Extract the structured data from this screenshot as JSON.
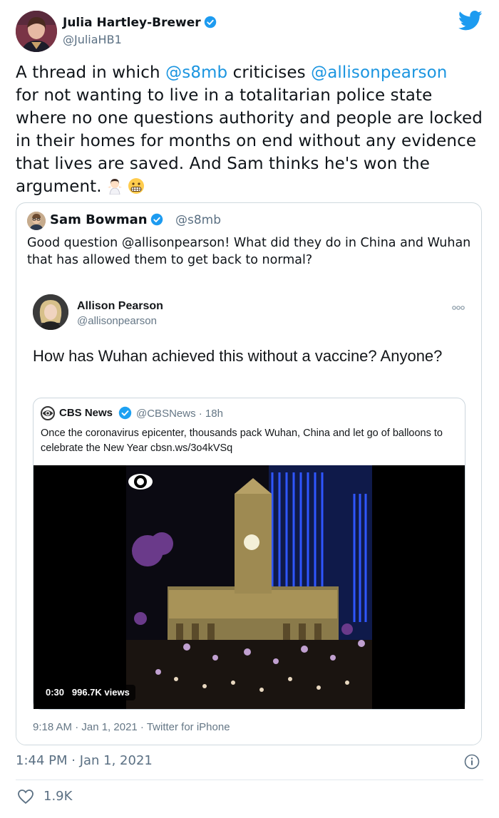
{
  "main_tweet": {
    "author_name": "Julia Hartley-Brewer",
    "author_handle": "@JuliaHB1",
    "text_1": "A thread in which ",
    "mention_1": "@s8mb",
    "text_2": " criticises ",
    "mention_2": "@allisonpearson",
    "text_3": " for not wanting to live in a totalitarian police state where no one questions authority and people are locked in their homes for months on end without any evidence that lives are saved. And Sam thinks he's won the argument.",
    "timestamp": "1:44 PM · Jan 1, 2021",
    "likes": "1.9K"
  },
  "quoted_tweet": {
    "author_name": "Sam Bowman",
    "author_handle": "@s8mb",
    "text": "Good question @allisonpearson! What did they do in China and Wuhan that has allowed them to get back to normal?"
  },
  "screenshot_tweet": {
    "author_name": "Allison Pearson",
    "author_handle": "@allisonpearson",
    "text": "How has Wuhan achieved this without a vaccine? Anyone?",
    "meta": "9:18 AM · Jan 1, 2021 · Twitter for iPhone"
  },
  "cbs_tweet": {
    "author_name": "CBS News",
    "handle_time": "@CBSNews · 18h",
    "text": "Once the coronavirus epicenter, thousands pack Wuhan, China and let go of balloons to celebrate the New Year cbsn.ws/3o4kVSq",
    "video_time": "0:30",
    "video_views": "996.7K views"
  },
  "colors": {
    "link": "#1b95e0",
    "twitter_blue": "#1d9bf0",
    "muted": "#5b7083"
  },
  "icons": [
    "verified-badge-icon",
    "twitter-bird-icon",
    "info-icon",
    "heart-icon",
    "more-icon",
    "cbs-eye-icon"
  ]
}
